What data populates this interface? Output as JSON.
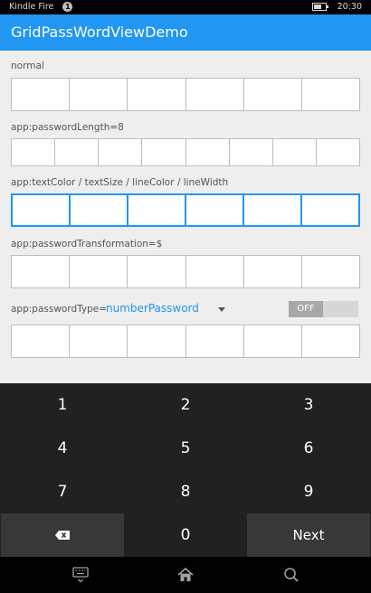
{
  "status_bar": {
    "carrier": "Kindle Fire",
    "notification_count": "1",
    "battery_level": 0.6,
    "time": "20:30"
  },
  "app": {
    "title": "GridPassWordViewDemo"
  },
  "sections": {
    "normal": {
      "label": "normal",
      "cells": 6
    },
    "length": {
      "label": "app:passwordLength=8",
      "cells": 8
    },
    "styled": {
      "label": "app:textColor / textSize / lineColor / lineWidth",
      "cells": 6,
      "line_color": "#2196f3"
    },
    "transformation": {
      "label": "app:passwordTransformation=$",
      "cells": 6
    },
    "type": {
      "label": "app:passwordType=",
      "selected": "numberPassword",
      "toggle_label": "OFF",
      "cells": 6
    }
  },
  "keyboard": {
    "keys": [
      "1",
      "2",
      "3",
      "4",
      "5",
      "6",
      "7",
      "8",
      "9",
      "",
      "0",
      "Next"
    ],
    "delete_icon": "backspace-icon"
  },
  "nav_bar": {
    "icons": [
      "keyboard-hide-icon",
      "home-icon",
      "search-icon"
    ]
  },
  "colors": {
    "accent": "#2196f3",
    "keyboard_bg": "#212121",
    "key_dark": "#383838"
  }
}
